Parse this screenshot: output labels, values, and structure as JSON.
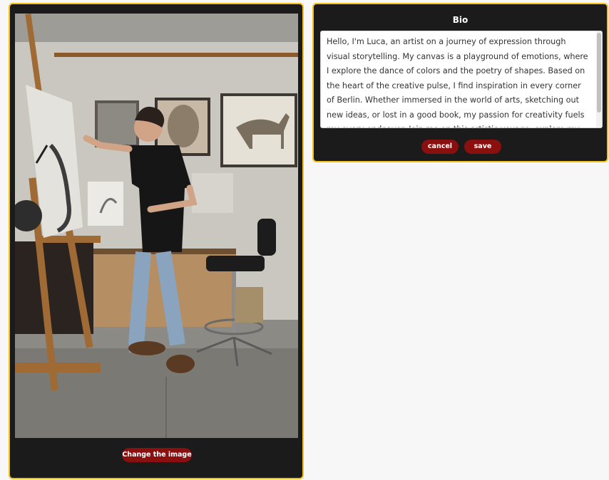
{
  "image_panel": {
    "change_label": "Change the image"
  },
  "bio_panel": {
    "title": "Bio",
    "text": "Hello, I'm Luca, an artist on a journey of expression through visual storytelling. My canvas is a playground of emotions, where I explore the dance of colors and the poetry of shapes. Based on the heart of the creative pulse, I find inspiration in every corner of Berlin. Whether immersed in the world of arts, sketching out new ideas, or lost in a good book, my passion for creativity fuels my every endeavor. Join me on this artistic voyage, explore my",
    "cancel_label": "cancel",
    "save_label": "save"
  },
  "colors": {
    "accent_border": "#f2c01d",
    "panel_bg": "#1c1b1b",
    "button_bg": "#8a0f0f"
  }
}
